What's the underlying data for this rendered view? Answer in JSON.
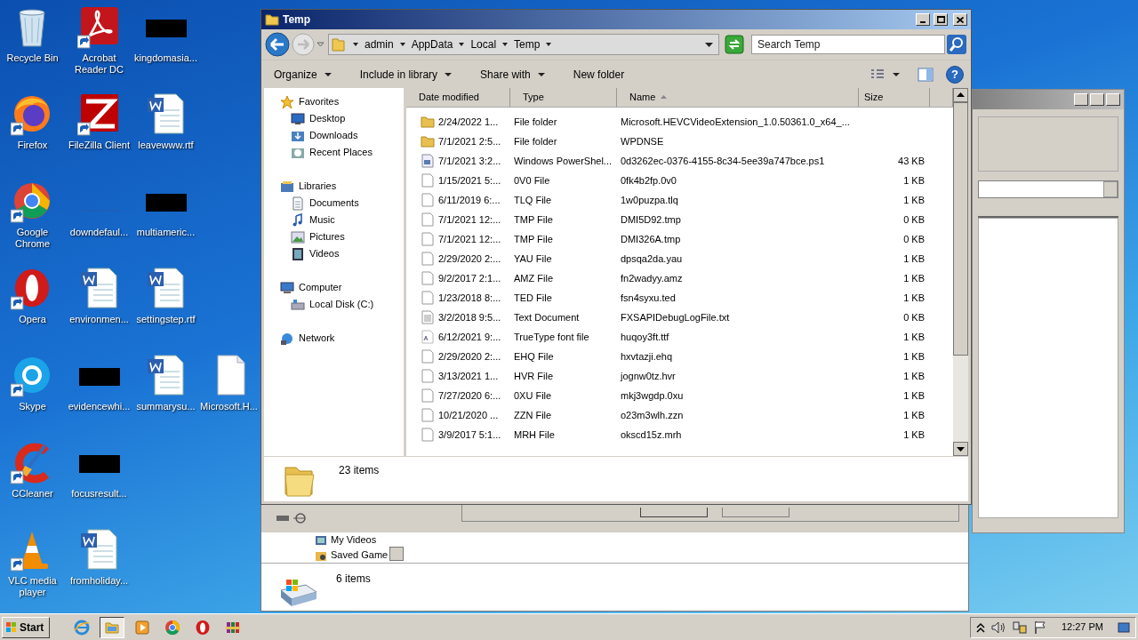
{
  "desktop": {
    "icon_rows": [
      [
        {
          "label": "Recycle Bin",
          "kind": "recycle"
        },
        {
          "label": "Acrobat Reader DC",
          "kind": "acrobat"
        },
        {
          "label": "kingdomasia...",
          "kind": "redacted"
        }
      ],
      [
        {
          "label": "Firefox",
          "kind": "firefox"
        },
        {
          "label": "FileZilla Client",
          "kind": "filezilla"
        },
        {
          "label": "leavewww.rtf",
          "kind": "word"
        }
      ],
      [
        {
          "label": "Google Chrome",
          "kind": "chrome"
        },
        {
          "label": "downdefaul...",
          "kind": "blank"
        },
        {
          "label": "multiameric...",
          "kind": "redacted"
        }
      ],
      [
        {
          "label": "Opera",
          "kind": "opera"
        },
        {
          "label": "environmen...",
          "kind": "word"
        },
        {
          "label": "settingstep.rtf",
          "kind": "word"
        }
      ],
      [
        {
          "label": "Skype",
          "kind": "skype"
        },
        {
          "label": "evidencewhi...",
          "kind": "redacted"
        },
        {
          "label": "summarysu...",
          "kind": "word"
        },
        {
          "label": "Microsoft.H...",
          "kind": "file"
        }
      ],
      [
        {
          "label": "CCleaner",
          "kind": "ccleaner"
        },
        {
          "label": "focusresult...",
          "kind": "redacted"
        }
      ],
      [
        {
          "label": "VLC media player",
          "kind": "vlc"
        },
        {
          "label": "fromholiday...",
          "kind": "word"
        }
      ]
    ]
  },
  "back_window_bottom": {
    "nav_items": [
      "My Videos",
      "Saved Game"
    ],
    "status": "6 items"
  },
  "explorer": {
    "title": "Temp",
    "breadcrumb": [
      "admin",
      "AppData",
      "Local",
      "Temp"
    ],
    "search": {
      "placeholder": "Search Temp"
    },
    "toolbar": [
      {
        "label": "Organize",
        "dropdown": true
      },
      {
        "label": "Include in library",
        "dropdown": true
      },
      {
        "label": "Share with",
        "dropdown": true
      },
      {
        "label": "New folder",
        "dropdown": false
      }
    ],
    "nav": [
      {
        "label": "Favorites",
        "kind": "star",
        "children": [
          {
            "label": "Desktop",
            "kind": "desktop"
          },
          {
            "label": "Downloads",
            "kind": "downloads"
          },
          {
            "label": "Recent Places",
            "kind": "recent"
          }
        ]
      },
      {
        "label": "Libraries",
        "kind": "library",
        "children": [
          {
            "label": "Documents",
            "kind": "documents"
          },
          {
            "label": "Music",
            "kind": "music"
          },
          {
            "label": "Pictures",
            "kind": "pictures"
          },
          {
            "label": "Videos",
            "kind": "videos"
          }
        ]
      },
      {
        "label": "Computer",
        "kind": "computer",
        "children": [
          {
            "label": "Local Disk (C:)",
            "kind": "disk"
          }
        ]
      },
      {
        "label": "Network",
        "kind": "network"
      }
    ],
    "columns": [
      {
        "label": "Date modified",
        "sorted": false
      },
      {
        "label": "Type",
        "sorted": false
      },
      {
        "label": "Name",
        "sorted": true
      },
      {
        "label": "Size",
        "sorted": false
      }
    ],
    "rows": [
      {
        "kind": "folder",
        "date": "2/24/2022 1...",
        "type": "File folder",
        "name": "Microsoft.HEVCVideoExtension_1.0.50361.0_x64_...",
        "size": ""
      },
      {
        "kind": "folder",
        "date": "7/1/2021 2:5...",
        "type": "File folder",
        "name": "WPDNSE",
        "size": ""
      },
      {
        "kind": "script",
        "date": "7/1/2021 3:2...",
        "type": "Windows PowerShel...",
        "name": "0d3262ec-0376-4155-8c34-5ee39a747bce.ps1",
        "size": "43 KB"
      },
      {
        "kind": "file",
        "date": "1/15/2021 5:...",
        "type": "0V0 File",
        "name": "0fk4b2fp.0v0",
        "size": "1 KB"
      },
      {
        "kind": "file",
        "date": "6/11/2019 6:...",
        "type": "TLQ File",
        "name": "1w0puzpa.tlq",
        "size": "1 KB"
      },
      {
        "kind": "file",
        "date": "7/1/2021 12:...",
        "type": "TMP File",
        "name": "DMI5D92.tmp",
        "size": "0 KB"
      },
      {
        "kind": "file",
        "date": "7/1/2021 12:...",
        "type": "TMP File",
        "name": "DMI326A.tmp",
        "size": "0 KB"
      },
      {
        "kind": "file",
        "date": "2/29/2020 2:...",
        "type": "YAU File",
        "name": "dpsqa2da.yau",
        "size": "1 KB"
      },
      {
        "kind": "file",
        "date": "9/2/2017 2:1...",
        "type": "AMZ File",
        "name": "fn2wadyy.amz",
        "size": "1 KB"
      },
      {
        "kind": "file",
        "date": "1/23/2018 8:...",
        "type": "TED File",
        "name": "fsn4syxu.ted",
        "size": "1 KB"
      },
      {
        "kind": "text",
        "date": "3/2/2018 9:5...",
        "type": "Text Document",
        "name": "FXSAPIDebugLogFile.txt",
        "size": "0 KB"
      },
      {
        "kind": "font",
        "date": "6/12/2021 9:...",
        "type": "TrueType font file",
        "name": "huqoy3ft.ttf",
        "size": "1 KB"
      },
      {
        "kind": "file",
        "date": "2/29/2020 2:...",
        "type": "EHQ File",
        "name": "hxvtazji.ehq",
        "size": "1 KB"
      },
      {
        "kind": "file",
        "date": "3/13/2021 1...",
        "type": "HVR File",
        "name": "jognw0tz.hvr",
        "size": "1 KB"
      },
      {
        "kind": "file",
        "date": "7/27/2020 6:...",
        "type": "0XU File",
        "name": "mkj3wgdp.0xu",
        "size": "1 KB"
      },
      {
        "kind": "file",
        "date": "10/21/2020 ...",
        "type": "ZZN File",
        "name": "o23m3wlh.zzn",
        "size": "1 KB"
      },
      {
        "kind": "file",
        "date": "3/9/2017 5:1...",
        "type": "MRH File",
        "name": "okscd15z.mrh",
        "size": "1 KB"
      }
    ],
    "help": "?",
    "status": "23 items"
  },
  "taskbar": {
    "start": "Start",
    "apps": [
      {
        "kind": "ie",
        "active": false
      },
      {
        "kind": "explorer",
        "active": true
      },
      {
        "kind": "media",
        "active": false
      },
      {
        "kind": "chrome",
        "active": false
      },
      {
        "kind": "opera",
        "active": false
      },
      {
        "kind": "winrar",
        "active": false
      }
    ],
    "clock": "12:27 PM"
  }
}
